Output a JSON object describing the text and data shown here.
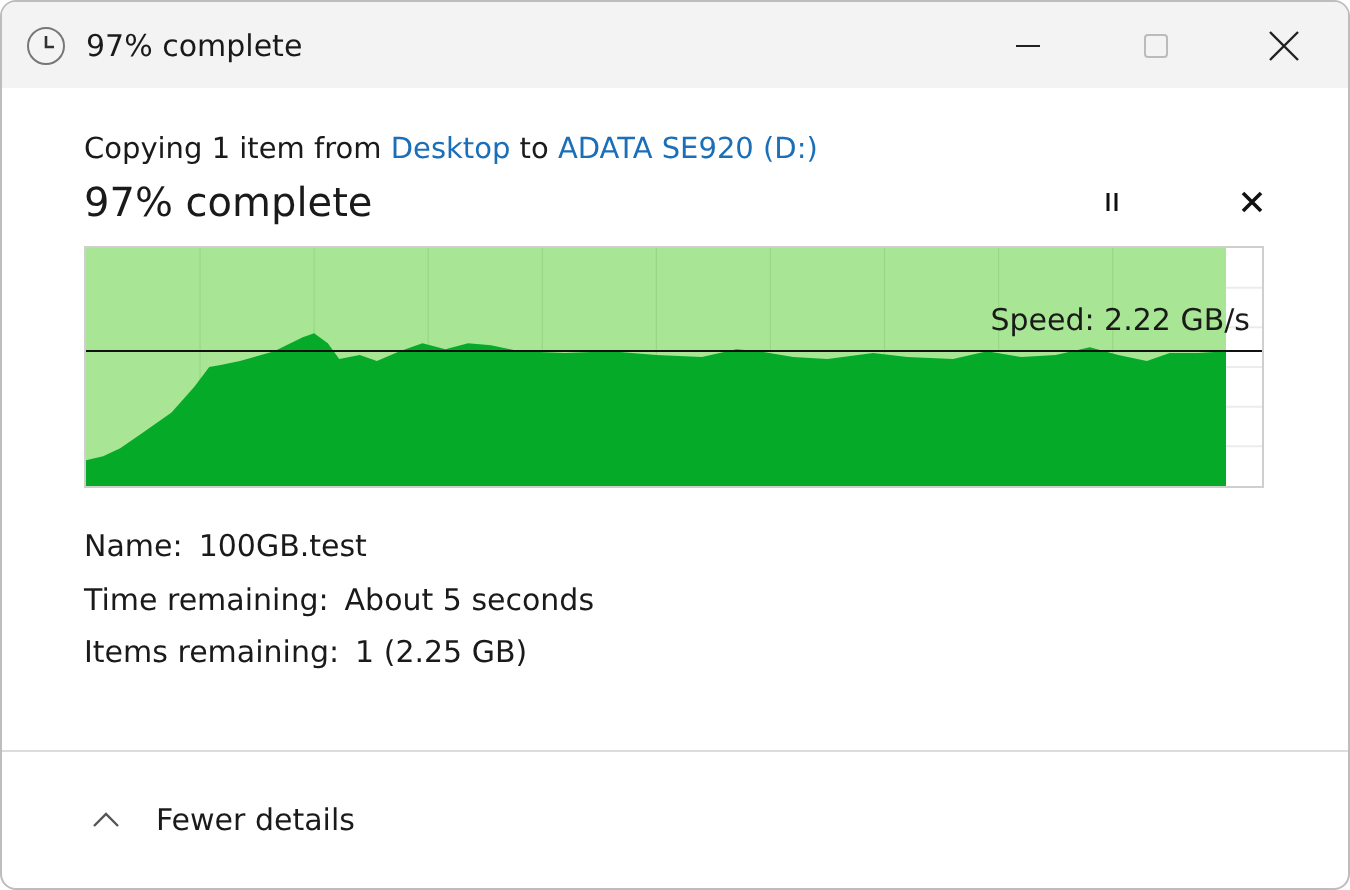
{
  "window": {
    "title": "97% complete"
  },
  "summary": {
    "prefix": "Copying 1 item from",
    "source": "Desktop",
    "joiner": "to",
    "destination": "ADATA SE920 (D:)"
  },
  "heading": "97% complete",
  "progress": {
    "level": 0.97,
    "speed": "Speed: 2.22 GB/s"
  },
  "details": [
    {
      "label": "Name:",
      "value": "100GB.test"
    },
    {
      "label": "Time remaining:",
      "value": "About 5 seconds"
    },
    {
      "label": "Items remaining:",
      "value": "1 (2.25 GB)"
    }
  ],
  "footer": {
    "toggle": "Fewer details",
    "expanded": true
  }
}
